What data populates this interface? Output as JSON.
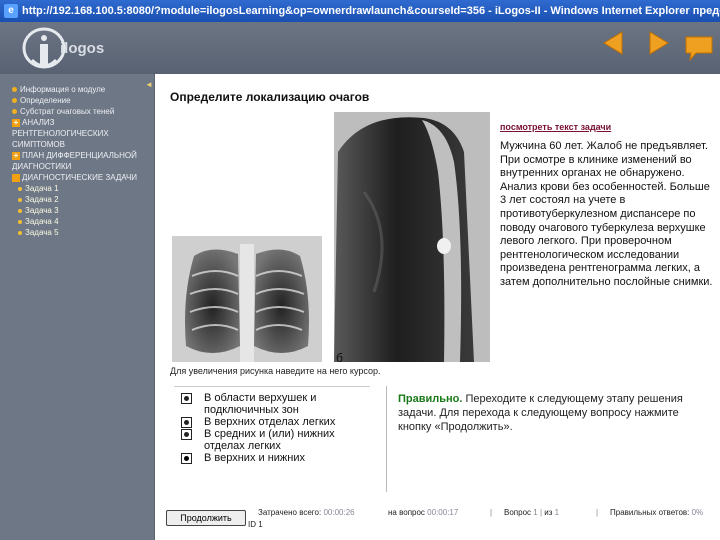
{
  "window": {
    "title": "http://192.168.100.5:8080/?module=ilogosLearning&op=ownerdrawlaunch&courseId=356 - iLogos-II - Windows Internet Explorer предос"
  },
  "header": {
    "logo_text": "ilogos",
    "icons": [
      "prev-arrow-icon",
      "next-arrow-icon",
      "message-icon"
    ]
  },
  "sidebar": {
    "items": [
      {
        "label": "Информация о модуле",
        "marker": "bullet"
      },
      {
        "label": "Определение",
        "marker": "bullet"
      },
      {
        "label": "Субстрат очаговых теней",
        "marker": "bullet"
      },
      {
        "label": "АНАЛИЗ РЕНТГЕНОЛОГИЧЕСКИХ СИМПТОМОВ",
        "marker": "plus"
      },
      {
        "label": "ПЛАН ДИФФЕРЕНЦИАЛЬНОЙ ДИАГНОСТИКИ",
        "marker": "plus"
      },
      {
        "label": "ДИАГНОСТИЧЕСКИЕ ЗАДАЧИ",
        "marker": "square"
      }
    ],
    "subitems": [
      "Задача 1",
      "Задача 2",
      "Задача 3",
      "Задача 4",
      "Задача 5"
    ],
    "toggle": "◄"
  },
  "main": {
    "title": "Определите локализацию очагов",
    "image_label_b": "б",
    "hint": "Для увеличения рисунка наведите на него курсор.",
    "task_link": "посмотреть текст задачи",
    "case_text": "Мужчина 60 лет. Жалоб не предъявляет. При осмотре в клинике изменений во внутренних органах не обнаружено. Анализ крови без особенностей. Больше 3 лет состоял на учете в противотуберкулезном диспансере по поводу очагового туберкулеза верхушке левого легкого. При проверочном рентгенологическом исследовании произведена рентгенограмма легких, а затем дополнительно послойные снимки.",
    "answers": [
      "В области верхушек и подключичных зон",
      "В верхних отделах легких",
      "В средних и (или) нижних отделах легких",
      "В верхних и нижних"
    ],
    "feedback_ok": "Правильно.",
    "feedback_text": " Переходите к следующему этапу решения задачи. Для перехода к следующему вопросу нажмите кнопку «Продолжить»."
  },
  "footer": {
    "continue_label": "Продолжить",
    "spent_total_label": "Затрачено всего:",
    "spent_total_value": "00:00:26",
    "per_question_label": "на вопрос",
    "per_question_value": "00:00:17",
    "question_label": "Вопрос",
    "question_value": "1",
    "of_label": "из",
    "of_value": "1",
    "correct_label": "Правильных ответов:",
    "correct_value": "0%",
    "id_label": "ID",
    "id_value": "1"
  }
}
